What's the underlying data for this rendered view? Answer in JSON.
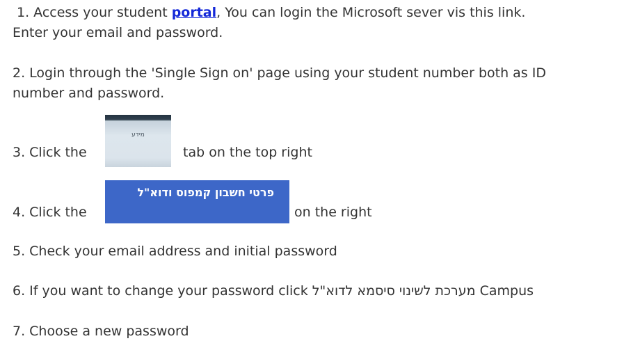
{
  "steps": {
    "s1": {
      "prefix": "1. Access your student ",
      "link_text": "portal",
      "suffix": ", You can login the Microsoft sever vis this link.",
      "line2": "Enter your email and password."
    },
    "s2": {
      "line1": "2. Login through the 'Single Sign on' page using your student number both as ID",
      "line2": "number and password."
    },
    "s3": {
      "prefix": "3. Click the",
      "tab_label": "מידע",
      "suffix": "tab on the top right"
    },
    "s4": {
      "prefix": "4. Click the",
      "button_label": "פרטי חשבון קמפוס ודוא\"ל",
      "suffix": "on the right"
    },
    "s5": {
      "text": "5. Check your email address and initial password"
    },
    "s6": {
      "prefix": "6. If you want to change your password click",
      "hebrew": "מערכת לשינוי סיסמא לדוא\"ל",
      "campus": "Campus"
    },
    "s7": {
      "text": "7. Choose a new password"
    }
  },
  "colors": {
    "link": "#1428d8",
    "button_bg": "#3d67c8",
    "text": "#333333"
  }
}
